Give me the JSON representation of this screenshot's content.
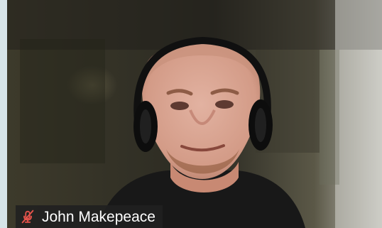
{
  "participant": {
    "name": "John Makepeace",
    "mic_state_icon": "microphone-muted-icon"
  },
  "colors": {
    "background": "#d7e4e8",
    "tile_background": "#202020",
    "muted_indicator": "#e5534b",
    "name_text": "#ffffff"
  }
}
